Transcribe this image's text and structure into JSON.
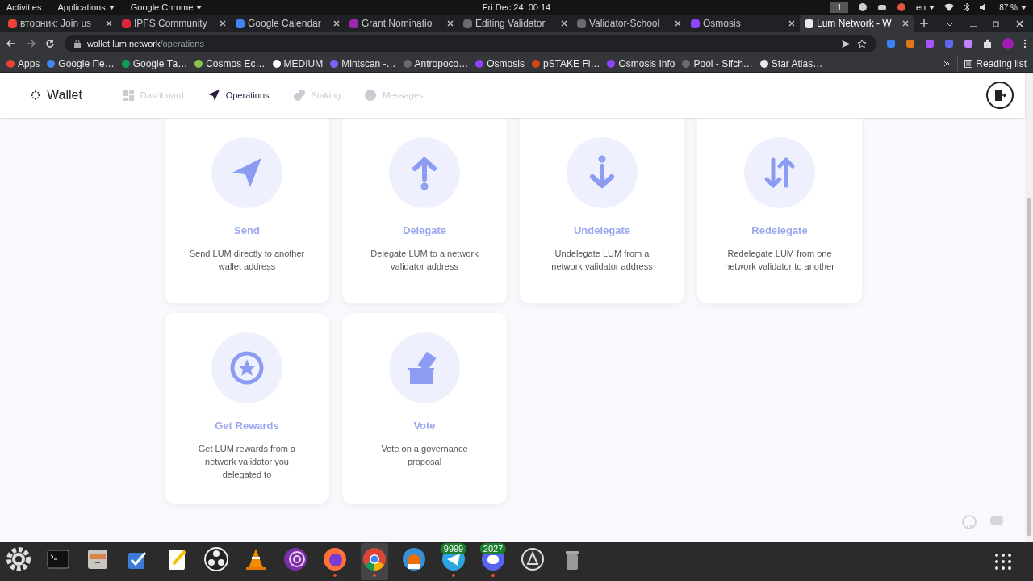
{
  "system_bar": {
    "activities": "Activities",
    "applications": "Applications",
    "app_menu": "Google Chrome",
    "clock": "Fri Dec 24  00:14",
    "workspace": "1",
    "language": "en",
    "battery": "87 %"
  },
  "tabs": [
    {
      "title": "вторник: Join us",
      "selected": false,
      "color": "#ea4335"
    },
    {
      "title": "IPFS Community",
      "selected": false,
      "color": "#e0243a"
    },
    {
      "title": "Google Calendar",
      "selected": false,
      "color": "#4285f4"
    },
    {
      "title": "Grant Nominatio",
      "selected": false,
      "color": "#9c27b0"
    },
    {
      "title": "Editing Validator",
      "selected": false,
      "color": "#6b6b6b"
    },
    {
      "title": "Validator-School",
      "selected": false,
      "color": "#6b6b6b"
    },
    {
      "title": "Osmosis",
      "selected": false,
      "color": "#8e44ff"
    },
    {
      "title": "Lum Network - W",
      "selected": true,
      "color": "#e8eaed"
    }
  ],
  "address": {
    "host": "wallet.lum.network",
    "path": "/operations"
  },
  "bookmarks": [
    {
      "label": "Apps",
      "color": "#ea4335"
    },
    {
      "label": "Google Пе…",
      "color": "#4285f4"
    },
    {
      "label": "Google Та…",
      "color": "#0f9d58"
    },
    {
      "label": "Cosmos Ec…",
      "color": "#8bc34a"
    },
    {
      "label": "MEDIUM",
      "color": "#ffffff"
    },
    {
      "label": "Mintscan -…",
      "color": "#7b61ff"
    },
    {
      "label": "Antropoco…",
      "color": "#6b6b6b"
    },
    {
      "label": "Osmosis",
      "color": "#8e44ff"
    },
    {
      "label": "pSTAKE Fi…",
      "color": "#d84315"
    },
    {
      "label": "Osmosis Info",
      "color": "#8e44ff"
    },
    {
      "label": "Pool - Sifch…",
      "color": "#6b6b6b"
    },
    {
      "label": "Star Atlas…",
      "color": "#e8eaed"
    }
  ],
  "reading_list": "Reading list",
  "app": {
    "logo": "Wallet",
    "nav": [
      {
        "label": "Dashboard",
        "kind": "dashboard",
        "selected": false
      },
      {
        "label": "Operations",
        "kind": "operations",
        "selected": true
      },
      {
        "label": "Staking",
        "kind": "staking",
        "selected": false
      },
      {
        "label": "Messages",
        "kind": "messages",
        "selected": false
      }
    ]
  },
  "operations": [
    {
      "kind": "send",
      "title": "Send",
      "description": "Send LUM directly to another wallet address"
    },
    {
      "kind": "delegate",
      "title": "Delegate",
      "description": "Delegate LUM to a network validator address"
    },
    {
      "kind": "undelegate",
      "title": "Undelegate",
      "description": "Undelegate LUM from a network validator address"
    },
    {
      "kind": "redelegate",
      "title": "Redelegate",
      "description": "Redelegate LUM from one network validator to another"
    },
    {
      "kind": "rewards",
      "title": "Get Rewards",
      "description": "Get LUM rewards from a network validator you delegated to"
    },
    {
      "kind": "vote",
      "title": "Vote",
      "description": "Vote on a governance proposal"
    }
  ],
  "dock": [
    {
      "kind": "settings",
      "running": false,
      "selected": false
    },
    {
      "kind": "terminal",
      "running": false,
      "selected": false
    },
    {
      "kind": "files",
      "running": false,
      "selected": false
    },
    {
      "kind": "tasks",
      "running": false,
      "selected": false
    },
    {
      "kind": "editor",
      "running": false,
      "selected": false
    },
    {
      "kind": "obs",
      "running": false,
      "selected": false
    },
    {
      "kind": "vlc",
      "running": false,
      "selected": false
    },
    {
      "kind": "tor",
      "running": false,
      "selected": false
    },
    {
      "kind": "firefox",
      "running": true,
      "selected": false
    },
    {
      "kind": "chrome",
      "running": true,
      "selected": true
    },
    {
      "kind": "fox",
      "running": false,
      "selected": false
    },
    {
      "kind": "telegram",
      "running": true,
      "selected": false,
      "badge": "9999"
    },
    {
      "kind": "discord",
      "running": true,
      "selected": false,
      "badge": "2027"
    },
    {
      "kind": "updater",
      "running": false,
      "selected": false
    },
    {
      "kind": "trash",
      "running": false,
      "selected": false
    }
  ]
}
